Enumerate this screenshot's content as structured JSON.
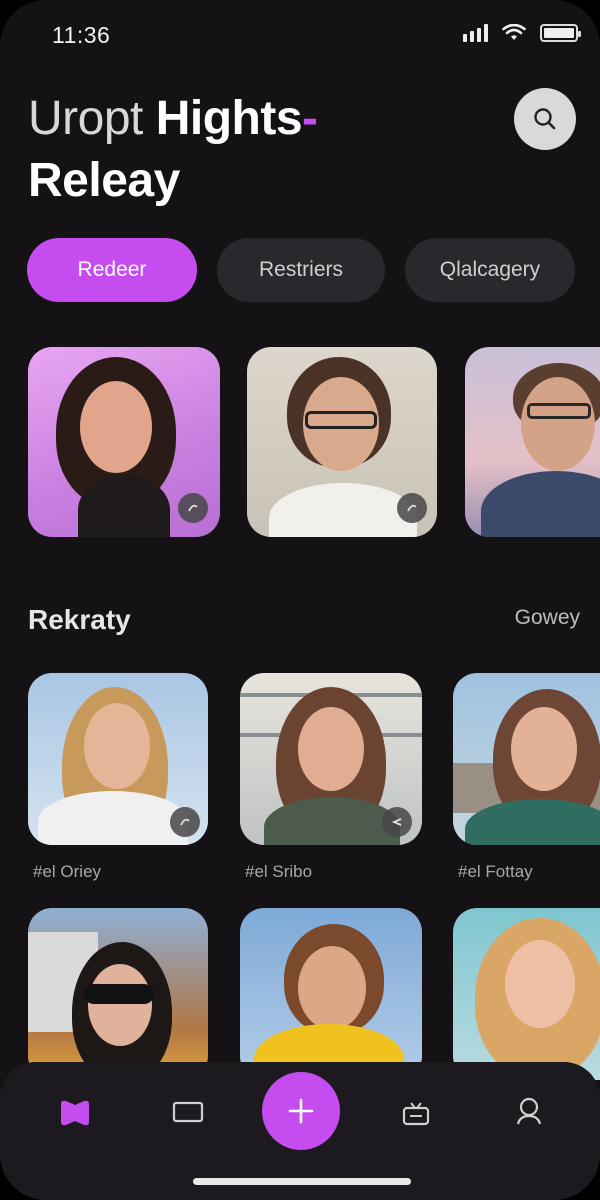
{
  "status_bar": {
    "time": "11:36"
  },
  "header": {
    "title_light": "Uropt ",
    "title_bold": "Hights",
    "title_accent": "-",
    "title_line2": "Releay"
  },
  "chips": [
    {
      "label": "Redeer",
      "active": true
    },
    {
      "label": "Restriers",
      "active": false
    },
    {
      "label": "Qlalcagery",
      "active": false
    }
  ],
  "section": {
    "title": "Rekraty",
    "link": "Gowey"
  },
  "captions": [
    "#el Oriey",
    "#el Sribo",
    "#el Fottay"
  ],
  "icons": {
    "search": "search-icon",
    "nav": [
      "home-icon",
      "screen-icon",
      "add-icon",
      "tv-icon",
      "profile-icon"
    ]
  },
  "colors": {
    "accent": "#c54df0",
    "background": "#141215",
    "chip_inactive": "#2a282c"
  }
}
